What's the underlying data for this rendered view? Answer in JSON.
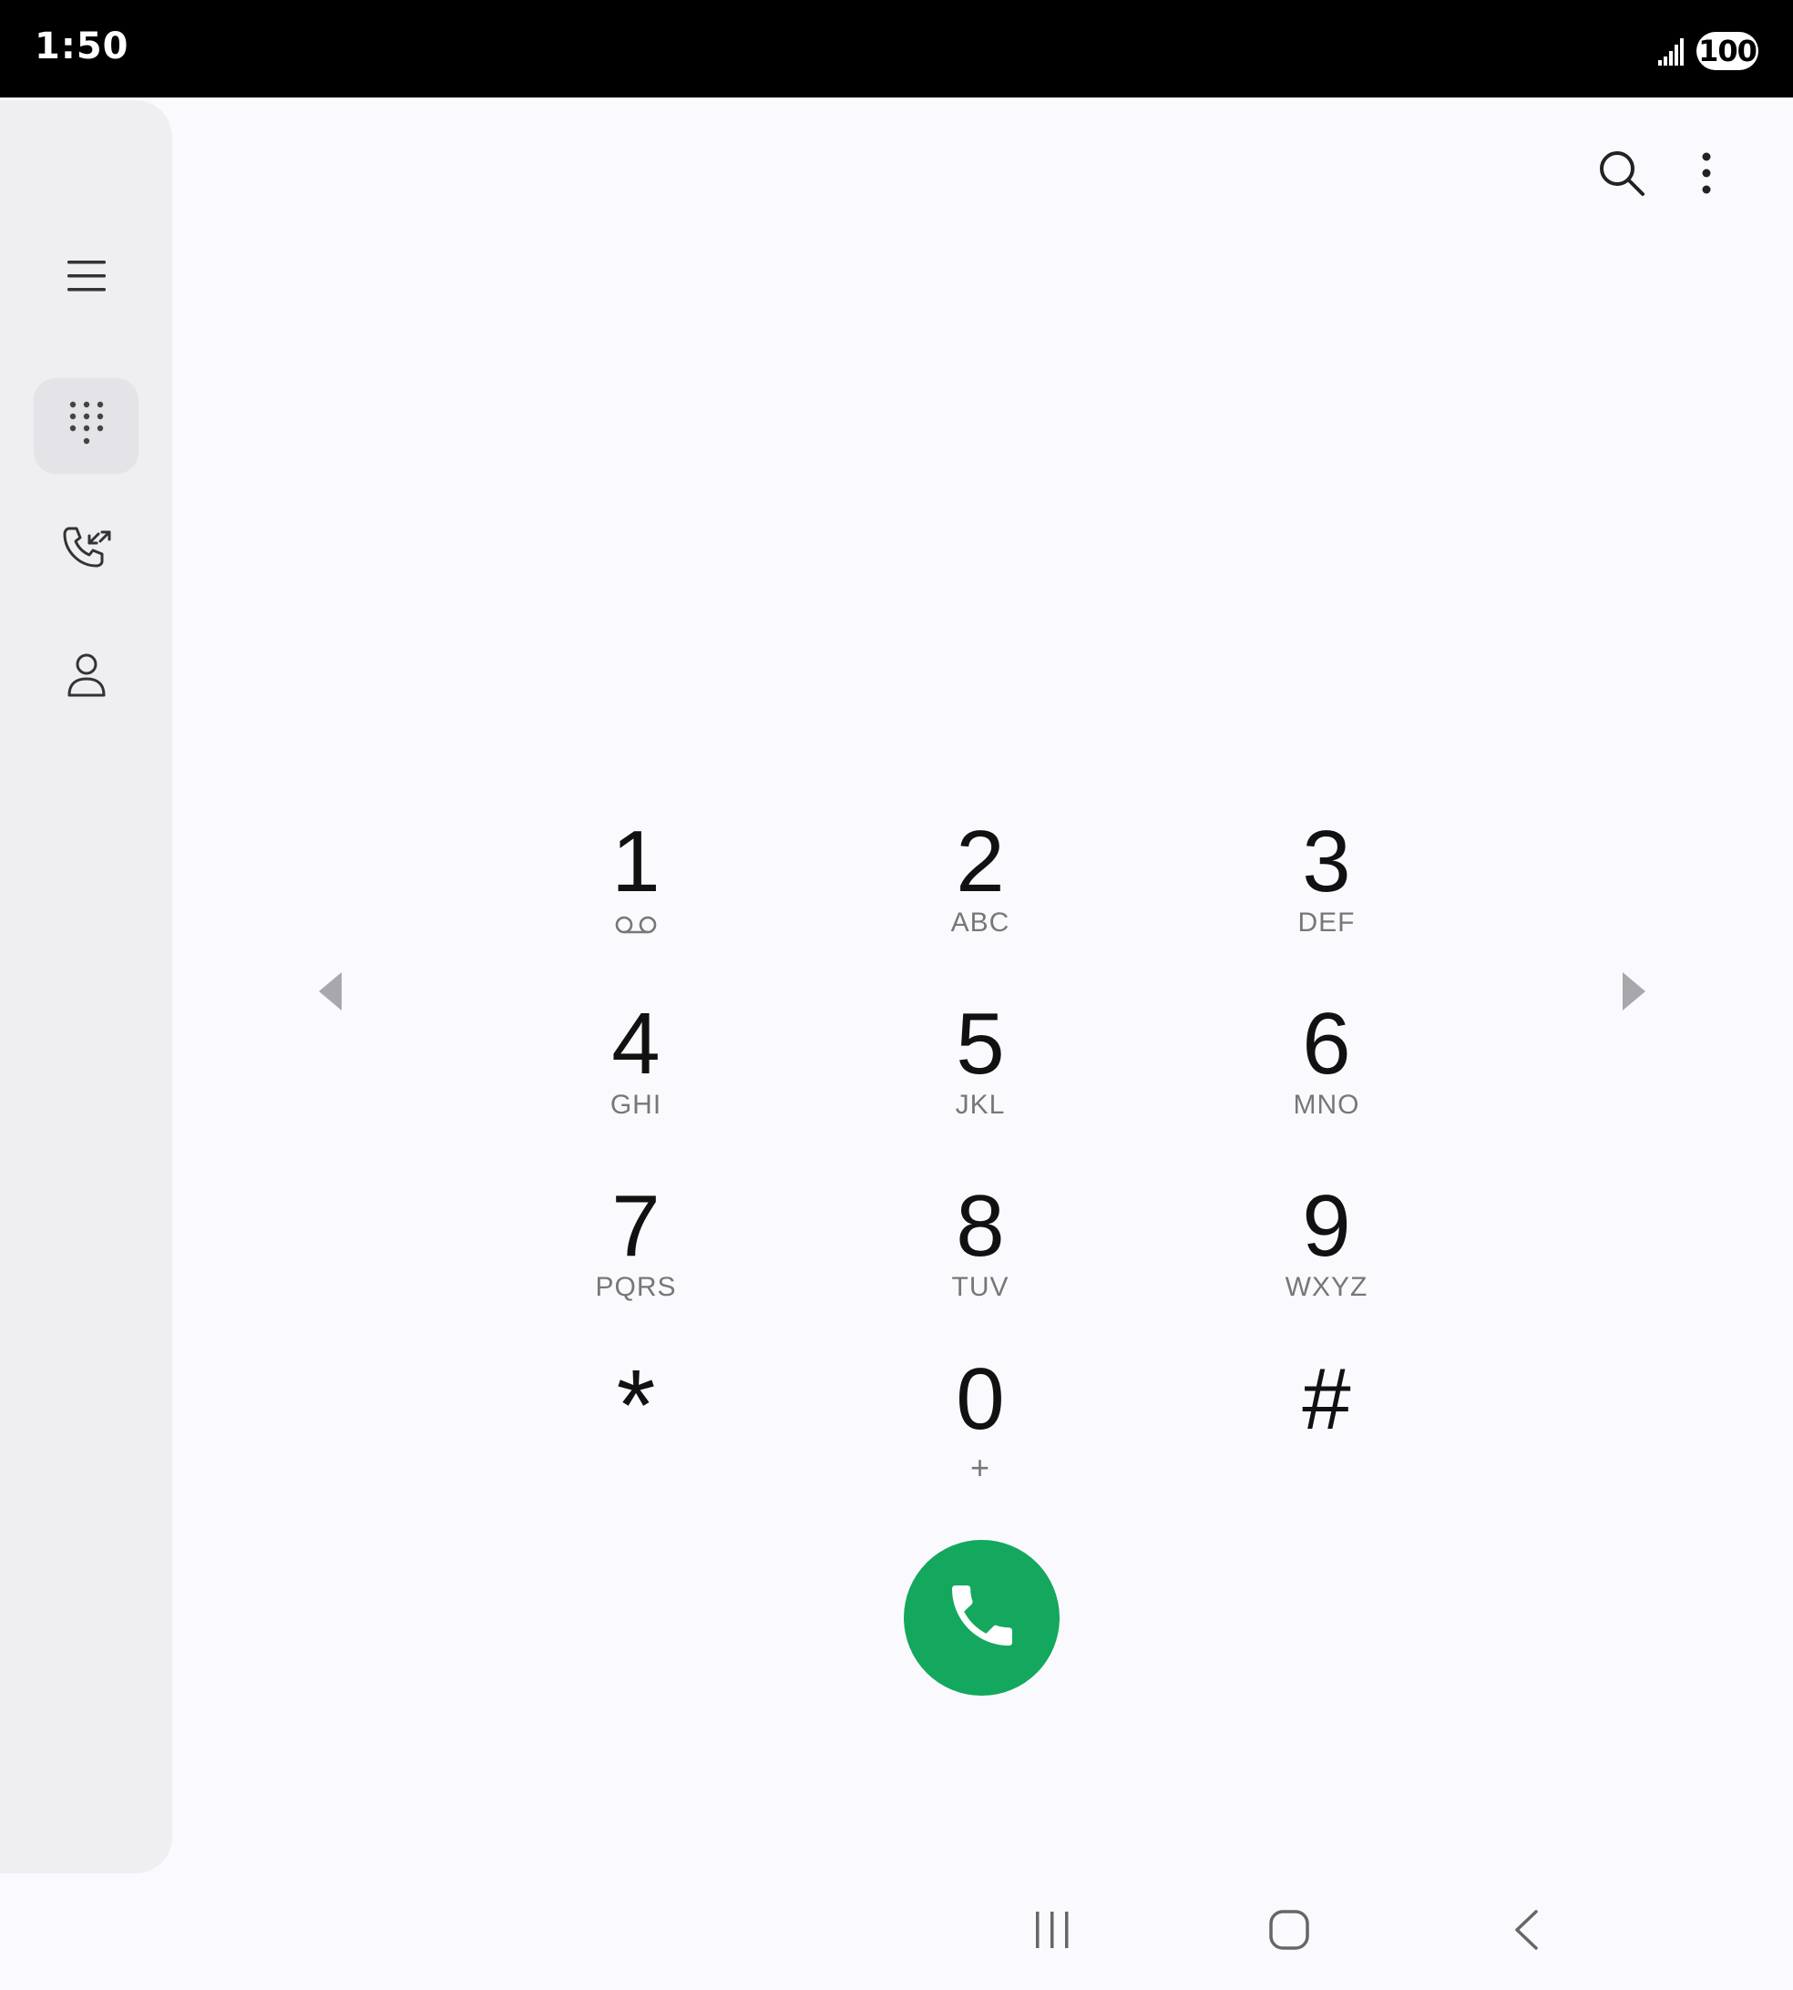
{
  "status_bar": {
    "time": "1:50",
    "battery": "100",
    "signal_icon": "signal-bars-icon"
  },
  "nav_rail": {
    "items": [
      {
        "name": "menu",
        "icon": "hamburger-menu-icon"
      },
      {
        "name": "keypad",
        "icon": "dialpad-icon",
        "selected": true
      },
      {
        "name": "recents",
        "icon": "call-log-icon"
      },
      {
        "name": "contacts",
        "icon": "person-icon"
      }
    ]
  },
  "toolbar": {
    "search_icon": "search-icon",
    "more_icon": "more-vertical-icon"
  },
  "keypad": {
    "keys": [
      {
        "digit": "1",
        "sub": "",
        "sub_icon": "voicemail-icon"
      },
      {
        "digit": "2",
        "sub": "ABC"
      },
      {
        "digit": "3",
        "sub": "DEF"
      },
      {
        "digit": "4",
        "sub": "GHI"
      },
      {
        "digit": "5",
        "sub": "JKL"
      },
      {
        "digit": "6",
        "sub": "MNO"
      },
      {
        "digit": "7",
        "sub": "PQRS"
      },
      {
        "digit": "8",
        "sub": "TUV"
      },
      {
        "digit": "9",
        "sub": "WXYZ"
      },
      {
        "digit": "*",
        "sub": ""
      },
      {
        "digit": "0",
        "sub": "+"
      },
      {
        "digit": "#",
        "sub": ""
      }
    ]
  },
  "call_button": {
    "icon": "phone-icon",
    "color": "#13a85d"
  },
  "system_nav": {
    "recents_icon": "recent-apps-icon",
    "home_icon": "home-icon",
    "back_icon": "back-icon"
  }
}
